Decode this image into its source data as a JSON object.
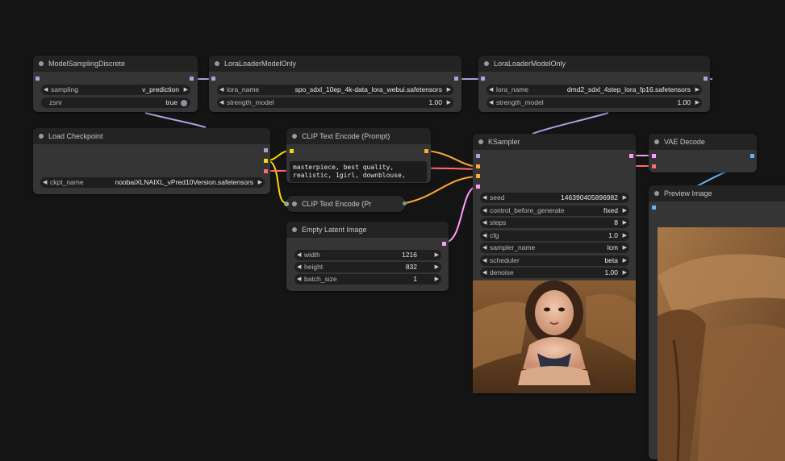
{
  "colors": {
    "model": "#b39ddb",
    "clip": "#ffd500",
    "vae": "#ff6e6e",
    "conditioning": "#ffa931",
    "latent": "#ff9cf9",
    "image": "#64b5f6"
  },
  "nodes": {
    "model_sampling": {
      "title": "ModelSamplingDiscrete",
      "sampling_label": "sampling",
      "sampling_value": "v_prediction",
      "zsnr_label": "zsnr",
      "zsnr_value": "true"
    },
    "lora1": {
      "title": "LoraLoaderModelOnly",
      "lora_name_label": "lora_name",
      "lora_name_value": "spo_sdxl_10ep_4k-data_lora_webui.safetensors",
      "strength_label": "strength_model",
      "strength_value": "1.00"
    },
    "lora2": {
      "title": "LoraLoaderModelOnly",
      "lora_name_label": "lora_name",
      "lora_name_value": "dmd2_sdxl_4step_lora_fp16.safetensors",
      "strength_label": "strength_model",
      "strength_value": "1.00"
    },
    "load_checkpoint": {
      "title": "Load Checkpoint",
      "ckpt_label": "ckpt_name",
      "ckpt_value": "noobaiXLNAIXL_vPred10Version.safetensors"
    },
    "clip_pos": {
      "title": "CLIP Text Encode (Prompt)",
      "text": "masterpiece, best quality,\nrealistic, 1girl, downblouse,"
    },
    "clip_neg": {
      "title": "CLIP Text Encode (Pr"
    },
    "empty_latent": {
      "title": "Empty Latent Image",
      "width_label": "width",
      "width_value": "1216",
      "height_label": "height",
      "height_value": "832",
      "batch_label": "batch_size",
      "batch_value": "1"
    },
    "ksampler": {
      "title": "KSampler",
      "widgets": [
        {
          "label": "seed",
          "value": "146390405896982"
        },
        {
          "label": "control_before_generate",
          "value": "fixed"
        },
        {
          "label": "steps",
          "value": "8"
        },
        {
          "label": "cfg",
          "value": "1.0"
        },
        {
          "label": "sampler_name",
          "value": "lcm"
        },
        {
          "label": "scheduler",
          "value": "beta"
        },
        {
          "label": "denoise",
          "value": "1.00"
        }
      ]
    },
    "vae_decode": {
      "title": "VAE Decode"
    },
    "preview": {
      "title": "Preview Image"
    }
  }
}
